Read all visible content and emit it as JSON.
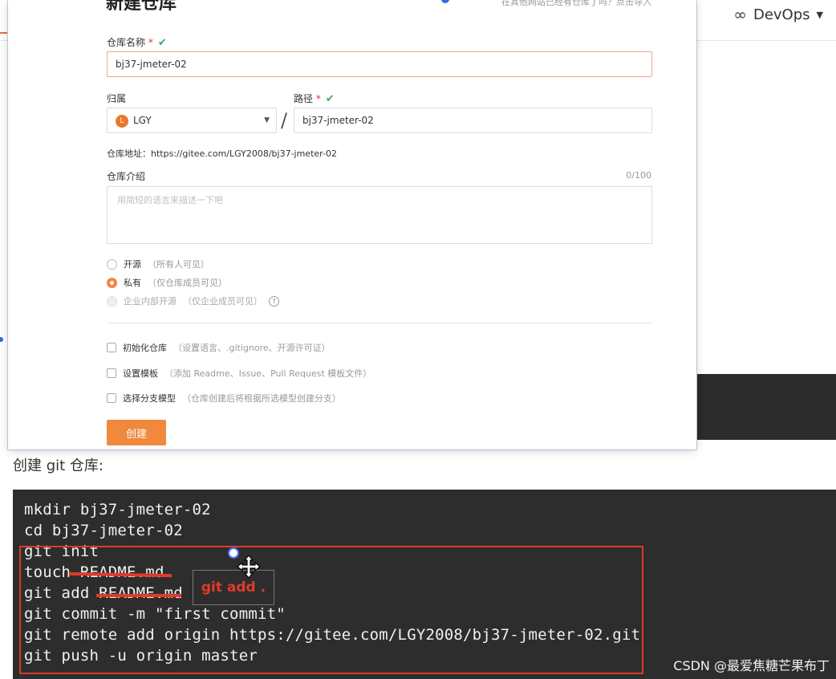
{
  "topbar": {
    "devops_label": "DevOps"
  },
  "dialog": {
    "title": "新建仓库",
    "hint": "在其他网站已经有仓库了吗？点击导入",
    "repo_name_label": "仓库名称",
    "repo_name_value": "bj37-jmeter-02",
    "owner_label": "归属",
    "owner_avatar_letter": "L",
    "owner_value": "LGY",
    "path_label": "路径",
    "path_value": "bj37-jmeter-02",
    "address_text": "仓库地址：https://gitee.com/LGY2008/bj37-jmeter-02",
    "intro_label": "仓库介绍",
    "intro_counter": "0/100",
    "intro_placeholder": "用简短的语言来描述一下吧",
    "visibility": [
      {
        "label": "开源",
        "note": "（所有人可见）",
        "state": "off"
      },
      {
        "label": "私有",
        "note": "（仅仓库成员可见）",
        "state": "on"
      },
      {
        "label": "企业内部开源",
        "note": "（仅企业成员可见）",
        "state": "disabled"
      }
    ],
    "options": [
      {
        "label": "初始化仓库",
        "note": "（设置语言、.gitignore、开源许可证）"
      },
      {
        "label": "设置模板",
        "note": "（添加 Readme、Issue、Pull Request 模板文件）"
      },
      {
        "label": "选择分支模型",
        "note": "（仓库创建后将根据所选模型创建分支）"
      }
    ],
    "create_button": "创建"
  },
  "section_title": "创建 git 仓库:",
  "terminal": {
    "lines": [
      "mkdir bj37-jmeter-02",
      "cd bj37-jmeter-02",
      "git init",
      "touch README.md",
      "git add README.md",
      "git commit -m \"first commit\"",
      "git remote add origin https://gitee.com/LGY2008/bj37-jmeter-02.git",
      "git push -u origin master"
    ],
    "annotation": "git add ."
  },
  "watermark": "CSDN @最爱焦糖芒果布丁",
  "colors": {
    "accent": "#f0883e",
    "annotation_red": "#e23a2b",
    "terminal_bg": "#2d2d2d"
  }
}
